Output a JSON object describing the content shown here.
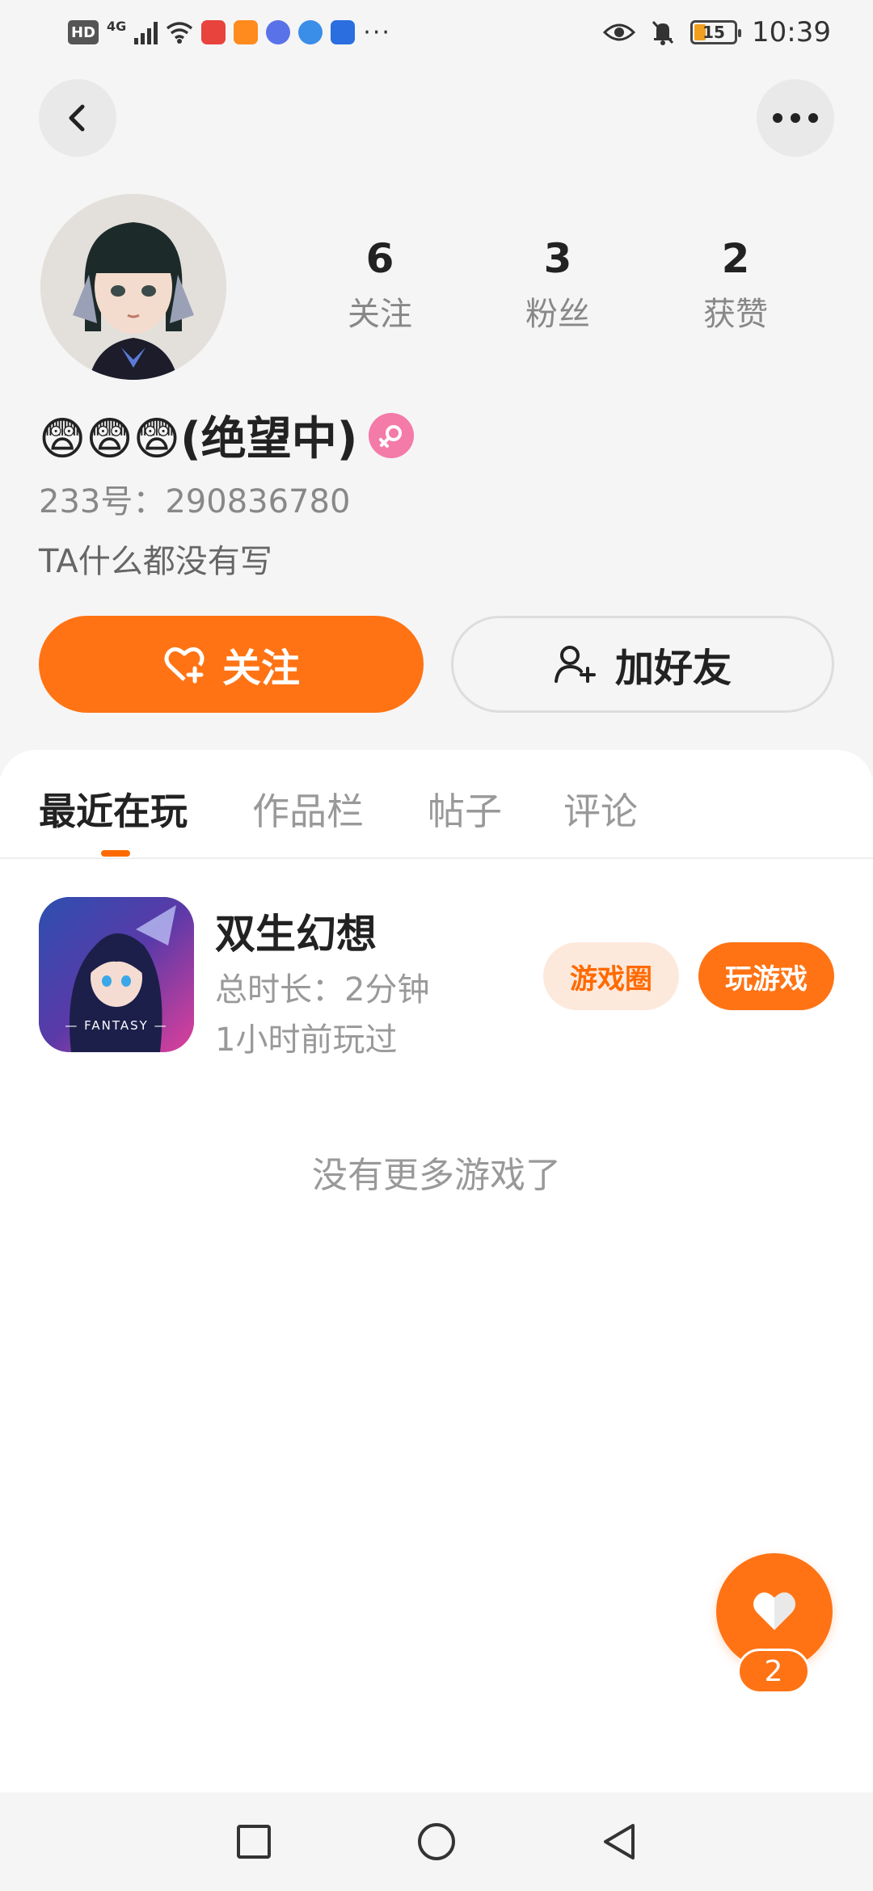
{
  "status_bar": {
    "left_badges": [
      "HD",
      "4G"
    ],
    "battery": "15",
    "time": "10:39",
    "overflow": "···"
  },
  "header": {
    "back_icon": "back-arrow-icon",
    "more_icon": "more-dots-icon"
  },
  "profile": {
    "stats": [
      {
        "value": "6",
        "label": "关注"
      },
      {
        "value": "3",
        "label": "粉丝"
      },
      {
        "value": "2",
        "label": "获赞"
      }
    ],
    "nickname": "😨😨😨(绝望中)",
    "gender_icon": "female-icon",
    "account_id": "233号：290836780",
    "bio": "TA什么都没有写",
    "follow_button": "关注",
    "add_friend_button": "加好友"
  },
  "tabs": [
    {
      "label": "最近在玩",
      "active": true
    },
    {
      "label": "作品栏",
      "active": false
    },
    {
      "label": "帖子",
      "active": false
    },
    {
      "label": "评论",
      "active": false
    }
  ],
  "games": [
    {
      "title": "双生幻想",
      "duration": "总时长：2分钟",
      "last_played": "1小时前玩过",
      "icon_text": "— FANTASY —",
      "circle_button": "游戏圈",
      "play_button": "玩游戏"
    }
  ],
  "empty_message": "没有更多游戏了",
  "like_fab": {
    "count": "2"
  },
  "colors": {
    "accent": "#ff7314",
    "accent_light": "#fde9dc",
    "gender": "#f47aa8"
  }
}
